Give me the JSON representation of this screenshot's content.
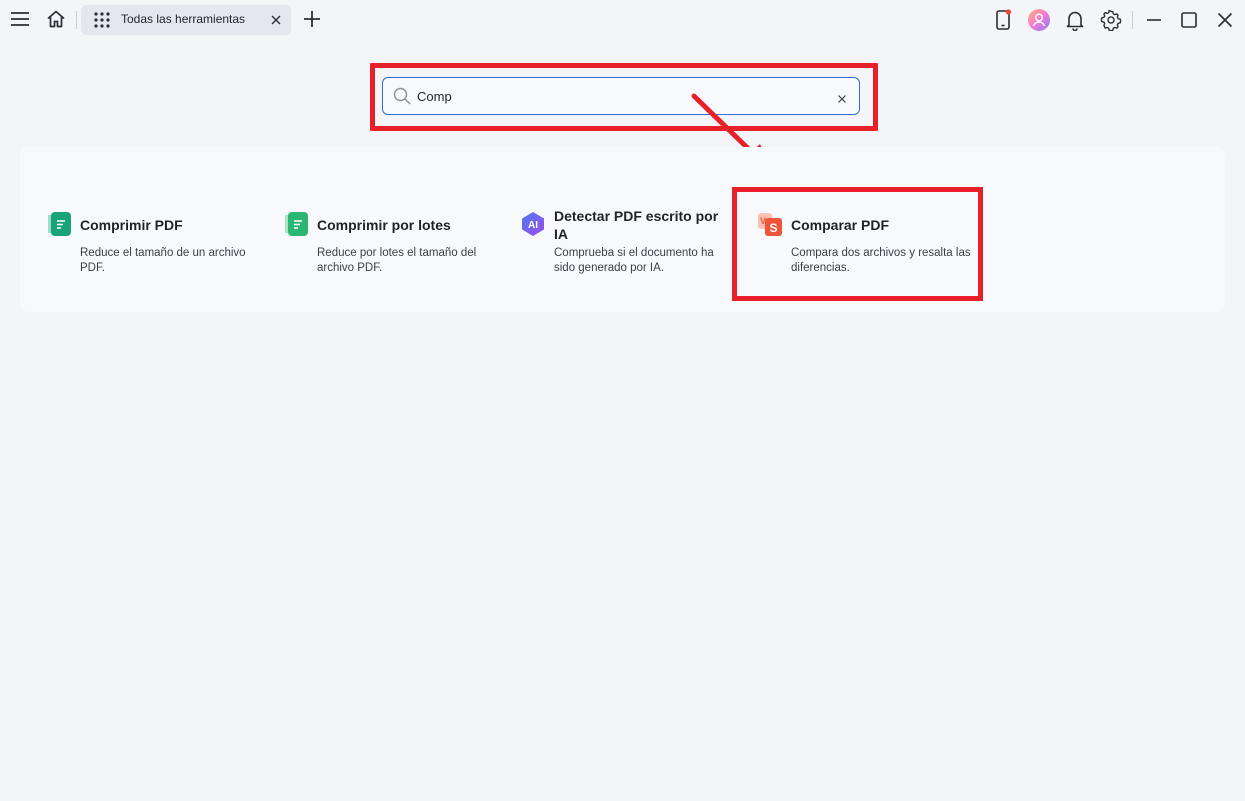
{
  "tabs": [
    {
      "label": "Todas las herramientas",
      "icon": "grid-icon"
    }
  ],
  "search": {
    "value": "Comp",
    "placeholder": ""
  },
  "results": [
    {
      "title": "Comprimir PDF",
      "description": "Reduce el tamaño de un archivo PDF.",
      "icon": "compress-pdf-icon",
      "color": "#1aa37a"
    },
    {
      "title": "Comprimir por lotes",
      "description": "Reduce por lotes el tamaño del archivo PDF.",
      "icon": "batch-compress-icon",
      "color": "#2bb673"
    },
    {
      "title": "Detectar PDF escrito por IA",
      "description": "Comprueba si el documento ha sido generado por IA.",
      "icon": "ai-detect-icon",
      "color": "#6a4de8"
    },
    {
      "title": "Comparar PDF",
      "description": "Compara dos archivos y resalta las diferencias.",
      "icon": "compare-pdf-icon",
      "color": "#f0553b"
    }
  ],
  "colors": {
    "highlight": "#e8202a",
    "accent": "#2f6fd6"
  }
}
